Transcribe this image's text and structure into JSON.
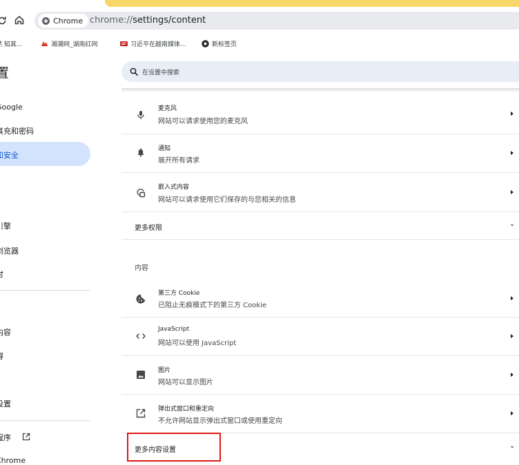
{
  "browser": {
    "chip_label": "Chrome",
    "url_scheme": "chrome://",
    "url_path": "settings/content"
  },
  "bookmarks": [
    {
      "label": "然 知其...",
      "icon": "none",
      "color": ""
    },
    {
      "label": "湘潮网_湖南红网",
      "icon": "hongwang-logo-icon",
      "color": "#d93025"
    },
    {
      "label": "习近平在越南媒体...",
      "icon": "news-logo-icon",
      "color": "#c5221f"
    },
    {
      "label": "新标签页",
      "icon": "chrome-logo-icon",
      "color": "#202124"
    }
  ],
  "header": {
    "title": "置",
    "search_placeholder": "在设置中搜索"
  },
  "sidebar": {
    "items": [
      {
        "label": "Google"
      },
      {
        "label": "真充和密码"
      },
      {
        "label": "和安全",
        "active": true
      },
      {
        "label": "引擎"
      },
      {
        "label": "浏览器"
      },
      {
        "label": "时"
      },
      {
        "label": "内容"
      },
      {
        "label": "得"
      },
      {
        "label": "设置"
      },
      {
        "label": "程序"
      },
      {
        "label": "Chrome"
      }
    ]
  },
  "main": {
    "rows_top": [
      {
        "title": "麦克风",
        "subtitle": "网站可以请求使用您的麦克风",
        "icon": "microphone-icon"
      },
      {
        "title": "通知",
        "subtitle": "展开所有请求",
        "icon": "bell-icon"
      },
      {
        "title": "嵌入式内容",
        "subtitle": "网站可以请求使用它们保存的与您相关的信息",
        "icon": "embedded-content-icon"
      }
    ],
    "more_permissions": "更多权限",
    "content_heading": "内容",
    "rows_content": [
      {
        "title": "第三方 Cookie",
        "subtitle": "已阻止无痕模式下的第三方 Cookie",
        "icon": "cookie-icon"
      },
      {
        "title": "JavaScript",
        "subtitle": "网站可以使用 JavaScript",
        "icon": "code-icon"
      },
      {
        "title": "图片",
        "subtitle": "网站可以显示图片",
        "icon": "image-icon"
      },
      {
        "title": "弹出式窗口和重定向",
        "subtitle": "不允许网站显示弹出式窗口或使用重定向",
        "icon": "open-in-new-icon"
      }
    ],
    "more_content_settings": "更多内容设置"
  },
  "colors": {
    "accent_active": "#d3e3fd",
    "search_bg": "#e9eef6",
    "highlight_box": "#e0140f",
    "notice_bar": "#f8d769"
  }
}
